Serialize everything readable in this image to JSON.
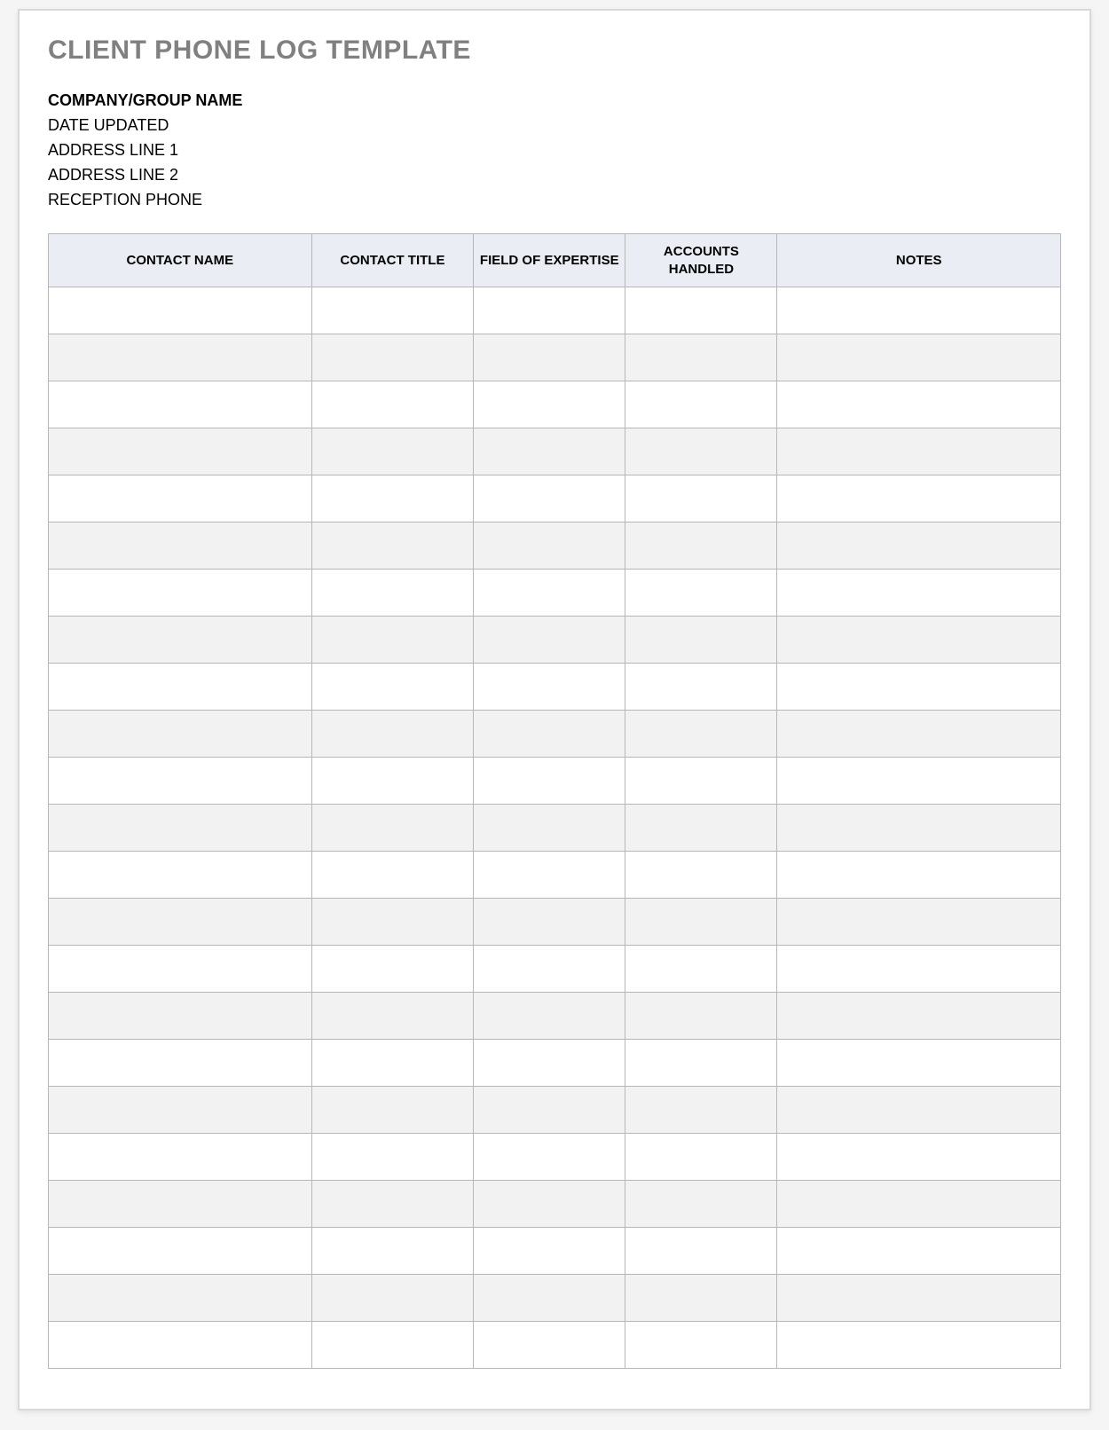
{
  "title": "CLIENT PHONE LOG TEMPLATE",
  "meta": {
    "company": "COMPANY/GROUP NAME",
    "date_updated": "DATE UPDATED",
    "address1": "ADDRESS LINE 1",
    "address2": "ADDRESS LINE 2",
    "reception_phone": "RECEPTION PHONE"
  },
  "table": {
    "headers": {
      "contact_name": "CONTACT NAME",
      "contact_title": "CONTACT TITLE",
      "field_of_expertise": "FIELD OF EXPERTISE",
      "accounts_handled": "ACCOUNTS HANDLED",
      "notes": "NOTES"
    },
    "rows": [
      {
        "contact_name": "",
        "contact_title": "",
        "field_of_expertise": "",
        "accounts_handled": "",
        "notes": ""
      },
      {
        "contact_name": "",
        "contact_title": "",
        "field_of_expertise": "",
        "accounts_handled": "",
        "notes": ""
      },
      {
        "contact_name": "",
        "contact_title": "",
        "field_of_expertise": "",
        "accounts_handled": "",
        "notes": ""
      },
      {
        "contact_name": "",
        "contact_title": "",
        "field_of_expertise": "",
        "accounts_handled": "",
        "notes": ""
      },
      {
        "contact_name": "",
        "contact_title": "",
        "field_of_expertise": "",
        "accounts_handled": "",
        "notes": ""
      },
      {
        "contact_name": "",
        "contact_title": "",
        "field_of_expertise": "",
        "accounts_handled": "",
        "notes": ""
      },
      {
        "contact_name": "",
        "contact_title": "",
        "field_of_expertise": "",
        "accounts_handled": "",
        "notes": ""
      },
      {
        "contact_name": "",
        "contact_title": "",
        "field_of_expertise": "",
        "accounts_handled": "",
        "notes": ""
      },
      {
        "contact_name": "",
        "contact_title": "",
        "field_of_expertise": "",
        "accounts_handled": "",
        "notes": ""
      },
      {
        "contact_name": "",
        "contact_title": "",
        "field_of_expertise": "",
        "accounts_handled": "",
        "notes": ""
      },
      {
        "contact_name": "",
        "contact_title": "",
        "field_of_expertise": "",
        "accounts_handled": "",
        "notes": ""
      },
      {
        "contact_name": "",
        "contact_title": "",
        "field_of_expertise": "",
        "accounts_handled": "",
        "notes": ""
      },
      {
        "contact_name": "",
        "contact_title": "",
        "field_of_expertise": "",
        "accounts_handled": "",
        "notes": ""
      },
      {
        "contact_name": "",
        "contact_title": "",
        "field_of_expertise": "",
        "accounts_handled": "",
        "notes": ""
      },
      {
        "contact_name": "",
        "contact_title": "",
        "field_of_expertise": "",
        "accounts_handled": "",
        "notes": ""
      },
      {
        "contact_name": "",
        "contact_title": "",
        "field_of_expertise": "",
        "accounts_handled": "",
        "notes": ""
      },
      {
        "contact_name": "",
        "contact_title": "",
        "field_of_expertise": "",
        "accounts_handled": "",
        "notes": ""
      },
      {
        "contact_name": "",
        "contact_title": "",
        "field_of_expertise": "",
        "accounts_handled": "",
        "notes": ""
      },
      {
        "contact_name": "",
        "contact_title": "",
        "field_of_expertise": "",
        "accounts_handled": "",
        "notes": ""
      },
      {
        "contact_name": "",
        "contact_title": "",
        "field_of_expertise": "",
        "accounts_handled": "",
        "notes": ""
      },
      {
        "contact_name": "",
        "contact_title": "",
        "field_of_expertise": "",
        "accounts_handled": "",
        "notes": ""
      },
      {
        "contact_name": "",
        "contact_title": "",
        "field_of_expertise": "",
        "accounts_handled": "",
        "notes": ""
      },
      {
        "contact_name": "",
        "contact_title": "",
        "field_of_expertise": "",
        "accounts_handled": "",
        "notes": ""
      }
    ]
  }
}
